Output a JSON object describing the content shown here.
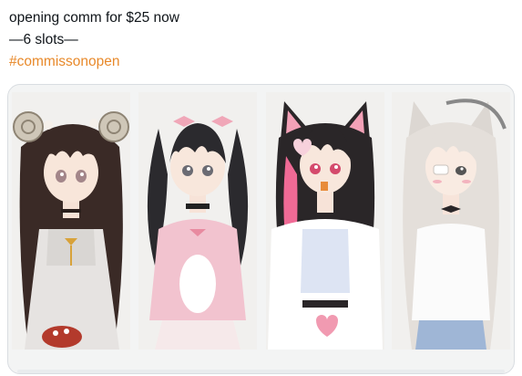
{
  "tweet": {
    "line1": "opening comm for $25 now",
    "line2": "—6 slots—",
    "hashtag": "#commissonopen"
  },
  "media": {
    "images": [
      {
        "name": "character-art-1"
      },
      {
        "name": "character-art-2"
      },
      {
        "name": "character-art-3"
      },
      {
        "name": "character-art-4"
      }
    ]
  },
  "colors": {
    "hashtag": "#e8892a",
    "border": "#d9dde1"
  }
}
